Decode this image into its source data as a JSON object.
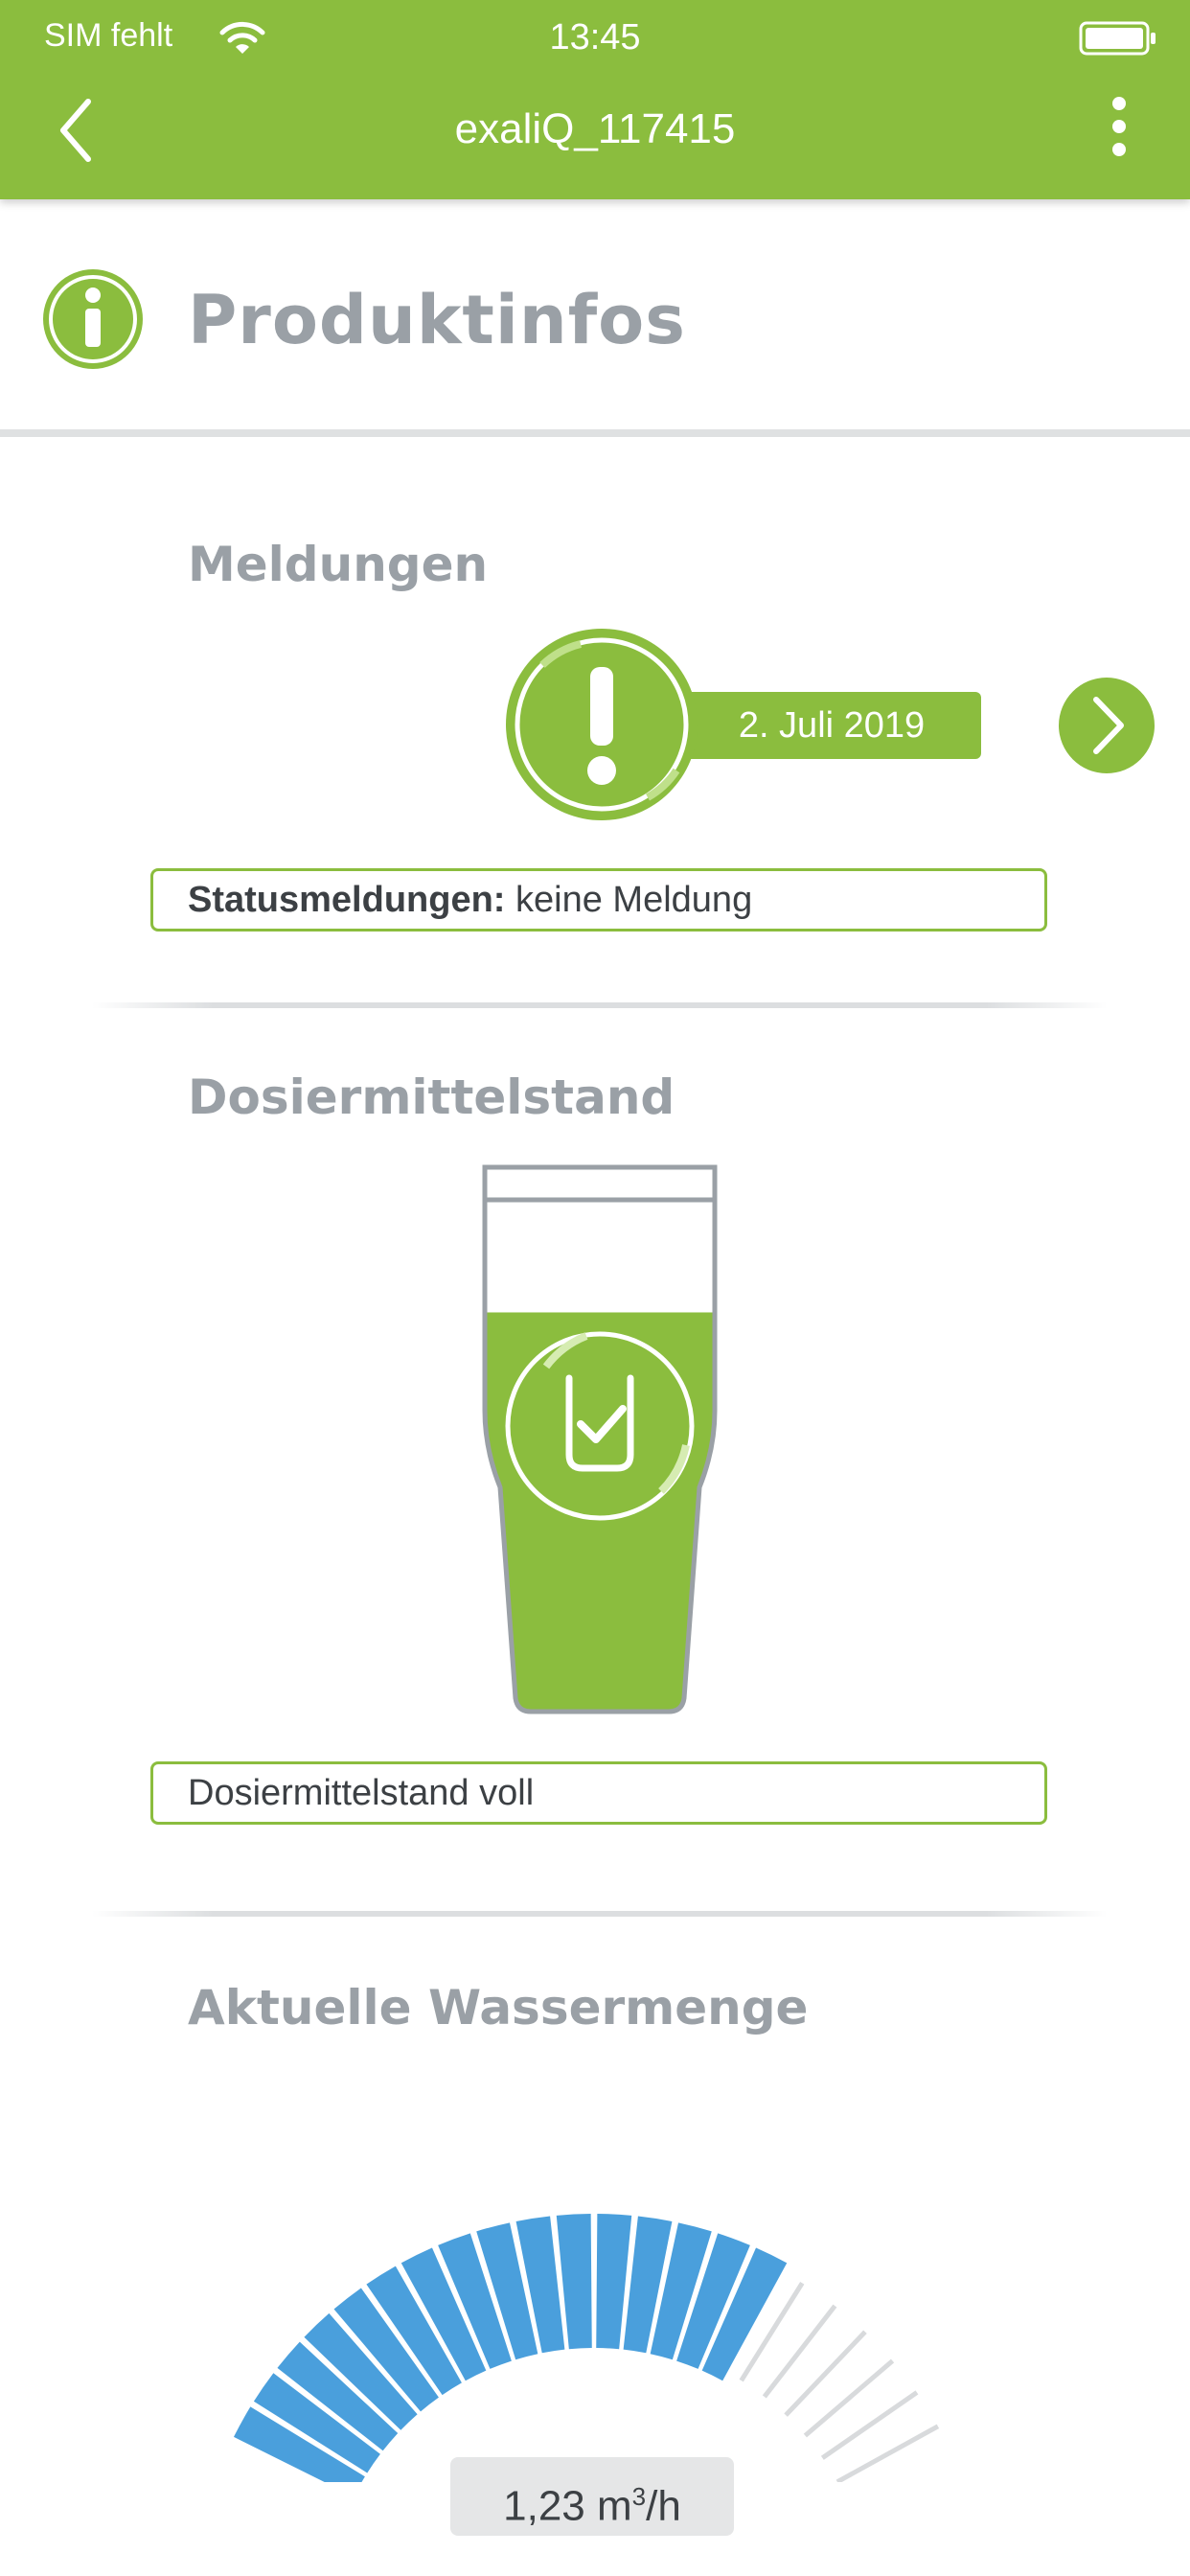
{
  "status_bar": {
    "carrier": "SIM fehlt",
    "time": "13:45"
  },
  "app_bar": {
    "title": "exaliQ_117415"
  },
  "page": {
    "title": "Produktinfos"
  },
  "messages": {
    "heading": "Meldungen",
    "date": "2. Juli 2019",
    "status_label": "Statusmeldungen:",
    "status_value": "keine Meldung"
  },
  "dosing": {
    "heading": "Dosiermittelstand",
    "level_text": "Dosiermittelstand voll",
    "fill_fraction": 0.78
  },
  "water": {
    "heading": "Aktuelle Wassermenge",
    "value_number": "1,23",
    "value_unit_base": "m",
    "value_unit_exp": "3",
    "value_unit_tail": "/h",
    "active_segments": 16,
    "total_segments": 22
  },
  "colors": {
    "brand_green": "#8bbd3e",
    "gauge_blue": "#4a9fdc",
    "heading_gray": "#9aa0a6"
  },
  "icons": [
    "wifi-icon",
    "battery-icon",
    "back-arrow-icon",
    "more-vert-icon",
    "info-icon",
    "exclamation-icon",
    "chevron-right-icon",
    "canister-check-icon"
  ]
}
